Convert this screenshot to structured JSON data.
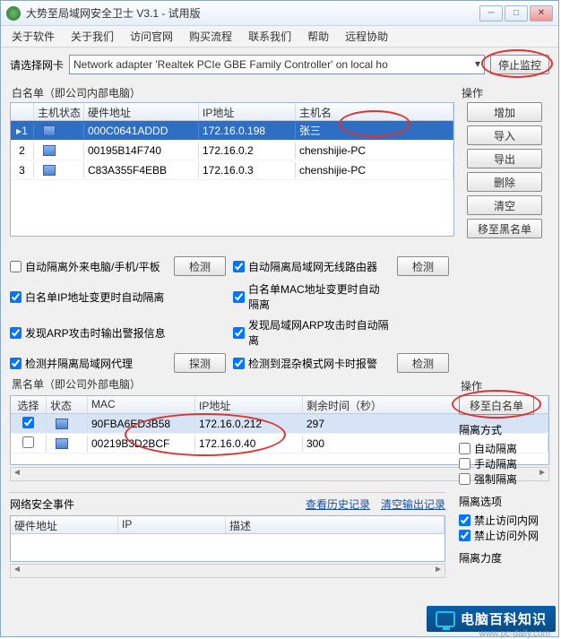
{
  "window": {
    "title": "大势至局域网安全卫士 V3.1 - 试用版"
  },
  "menu": [
    "关于软件",
    "关于我们",
    "访问官网",
    "购买流程",
    "联系我们",
    "帮助",
    "远程协助"
  ],
  "nic": {
    "label": "请选择网卡",
    "value": "Network adapter 'Realtek PCIe GBE Family Controller' on local ho",
    "stop_btn": "停止监控"
  },
  "whitelist": {
    "caption": "白名单（即公司内部电脑）",
    "ops_label": "操作",
    "headers": {
      "idx": "",
      "stat": "主机状态",
      "mac": "硬件地址",
      "ip": "IP地址",
      "host": "主机名"
    },
    "rows": [
      {
        "idx": "1",
        "mac": "000C0641ADDD",
        "ip": "172.16.0.198",
        "host": "张三",
        "sel": true
      },
      {
        "idx": "2",
        "mac": "00195B14F740",
        "ip": "172.16.0.2",
        "host": "chenshijie-PC"
      },
      {
        "idx": "3",
        "mac": "C83A355F4EBB",
        "ip": "172.16.0.3",
        "host": "chenshijie-PC"
      }
    ],
    "buttons": [
      "增加",
      "导入",
      "导出",
      "删除",
      "清空",
      "移至黑名单"
    ]
  },
  "options": {
    "r1a": "自动隔离外来电脑/手机/平板",
    "b1": "检测",
    "r1b": "自动隔离局域网无线路由器",
    "b1b": "检测",
    "r2a": "白名单IP地址变更时自动隔离",
    "r2b": "白名单MAC地址变更时自动隔离",
    "r3a": "发现ARP攻击时输出警报信息",
    "r3b": "发现局域网ARP攻击时自动隔离",
    "r4a": "检测并隔离局域网代理",
    "b4": "探测",
    "r4b": "检测到混杂模式网卡时报警",
    "b4b": "检测"
  },
  "blacklist": {
    "caption": "黑名单（即公司外部电脑）",
    "ops_label": "操作",
    "move_btn": "移至白名单",
    "headers": {
      "sel": "选择",
      "stat": "状态",
      "mac": "MAC",
      "ip": "IP地址",
      "time": "剩余时间（秒）"
    },
    "rows": [
      {
        "mac": "90FBA6ED3B58",
        "ip": "172.16.0.212",
        "time": "297",
        "sel": true,
        "checked": true
      },
      {
        "mac": "00219B3D2BCF",
        "ip": "172.16.0.40",
        "time": "300"
      }
    ]
  },
  "iso_mode": {
    "title": "隔离方式",
    "opts": [
      "自动隔离",
      "手动隔离",
      "强制隔离"
    ]
  },
  "iso_opt": {
    "title": "隔离选项",
    "opts": [
      "禁止访问内网",
      "禁止访问外网"
    ]
  },
  "iso_pow": {
    "title": "隔离力度"
  },
  "events": {
    "title": "网络安全事件",
    "link1": "查看历史记录",
    "link2": "清空输出记录",
    "h1": "硬件地址",
    "h2": "IP",
    "h3": "描述"
  },
  "brand": {
    "text": "电脑百科知识",
    "url": "www.pc-daily.com"
  }
}
